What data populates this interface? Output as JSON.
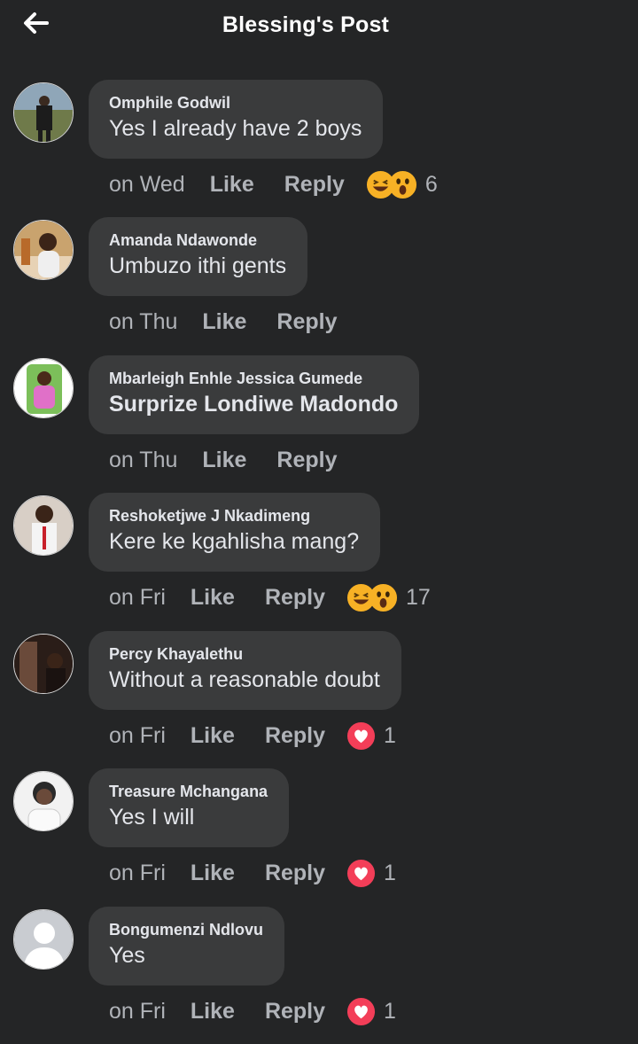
{
  "header": {
    "title": "Blessing's Post",
    "back_icon": "arrow-left-icon"
  },
  "actions": {
    "like_label": "Like",
    "reply_label": "Reply"
  },
  "colors": {
    "background": "#242526",
    "bubble": "#3a3b3c",
    "primary_text": "#e4e6eb",
    "secondary_text": "#b0b3b8",
    "love_red": "#f33e58",
    "haha_yellow": "#f7b125"
  },
  "comments": [
    {
      "author": "Omphile Godwil",
      "text": "Yes I already have 2 boys",
      "time": "on Wed",
      "reactions": [
        "haha-icon",
        "wow-icon"
      ],
      "reaction_count": "6"
    },
    {
      "author": "Amanda Ndawonde",
      "text": "Umbuzo ithi gents",
      "time": "on Thu",
      "reactions": [],
      "reaction_count": ""
    },
    {
      "author": "Mbarleigh Enhle Jessica Gumede",
      "text": "Surprize Londiwe Madondo",
      "time": "on Thu",
      "reactions": [],
      "reaction_count": ""
    },
    {
      "author": "Reshoketjwe J Nkadimeng",
      "text": "Kere ke kgahlisha mang?",
      "time": "on Fri",
      "reactions": [
        "haha-icon",
        "wow-icon"
      ],
      "reaction_count": "17"
    },
    {
      "author": "Percy Khayalethu",
      "text": "Without a reasonable doubt",
      "time": "on Fri",
      "reactions": [
        "love-icon"
      ],
      "reaction_count": "1"
    },
    {
      "author": "Treasure Mchangana",
      "text": "Yes I will",
      "time": "on Fri",
      "reactions": [
        "love-icon"
      ],
      "reaction_count": "1"
    },
    {
      "author": "Bongumenzi Ndlovu",
      "text": "Yes",
      "time": "on Fri",
      "reactions": [
        "love-icon"
      ],
      "reaction_count": "1"
    }
  ]
}
